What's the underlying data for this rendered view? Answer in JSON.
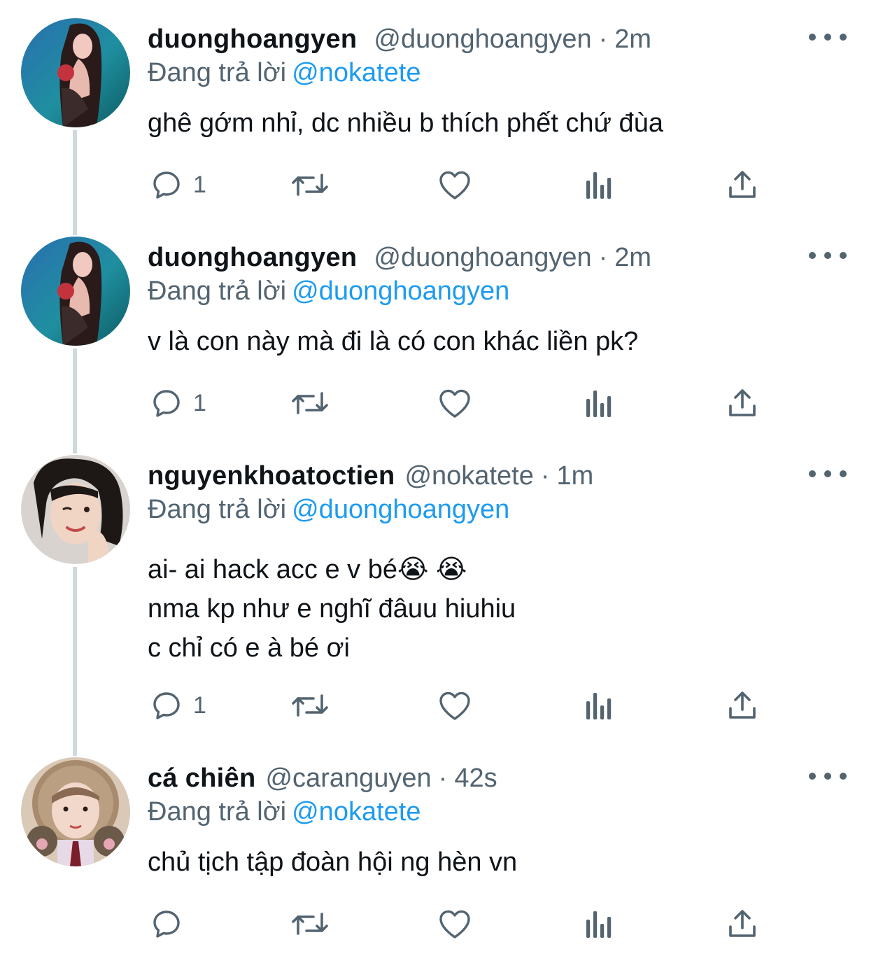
{
  "colors": {
    "accent": "#1d9bf0",
    "secondary_text": "#536471",
    "thread_line": "#cfd9de"
  },
  "tweets": [
    {
      "display_name": "duonghoangyen",
      "handle": "@duonghoangyen",
      "time": "2m",
      "reply_prefix": "Đang trả lời",
      "reply_mention": "@nokatete",
      "text": "ghê gớm nhỉ, dc nhiều b thích phết chứ đùa",
      "reply_count": "1",
      "avatar_icon": "avatar-photo-red-hair"
    },
    {
      "display_name": "duonghoangyen",
      "handle": "@duonghoangyen",
      "time": "2m",
      "reply_prefix": "Đang trả lời",
      "reply_mention": "@duonghoangyen",
      "text": "v là con này mà đi là có con khác liền pk?",
      "reply_count": "1",
      "avatar_icon": "avatar-photo-red-hair"
    },
    {
      "display_name": "nguyenkhoatoctien",
      "handle": "@nokatete",
      "time": "1m",
      "reply_prefix": "Đang trả lời",
      "reply_mention": "@duonghoangyen",
      "text": "ai- ai hack acc e v bé😭 😭\nnma kp như e nghĩ đâuu hiuhiu\nc chỉ có e à bé ơi",
      "reply_count": "1",
      "avatar_icon": "avatar-photo-winking-girl"
    },
    {
      "display_name": "cá chiên",
      "handle": "@caranguyen",
      "time": "42s",
      "reply_prefix": "Đang trả lời",
      "reply_mention": "@nokatete",
      "text": "chủ tịch tập đoàn hội ng hèn vn",
      "reply_count": "",
      "avatar_icon": "avatar-photo-fur-hood"
    }
  ],
  "icons": {
    "reply": "reply-bubble-icon",
    "retweet": "retweet-icon",
    "like": "heart-icon",
    "views": "views-bars-icon",
    "share": "share-upload-icon",
    "more": "more-dots-icon"
  },
  "separator": "·"
}
